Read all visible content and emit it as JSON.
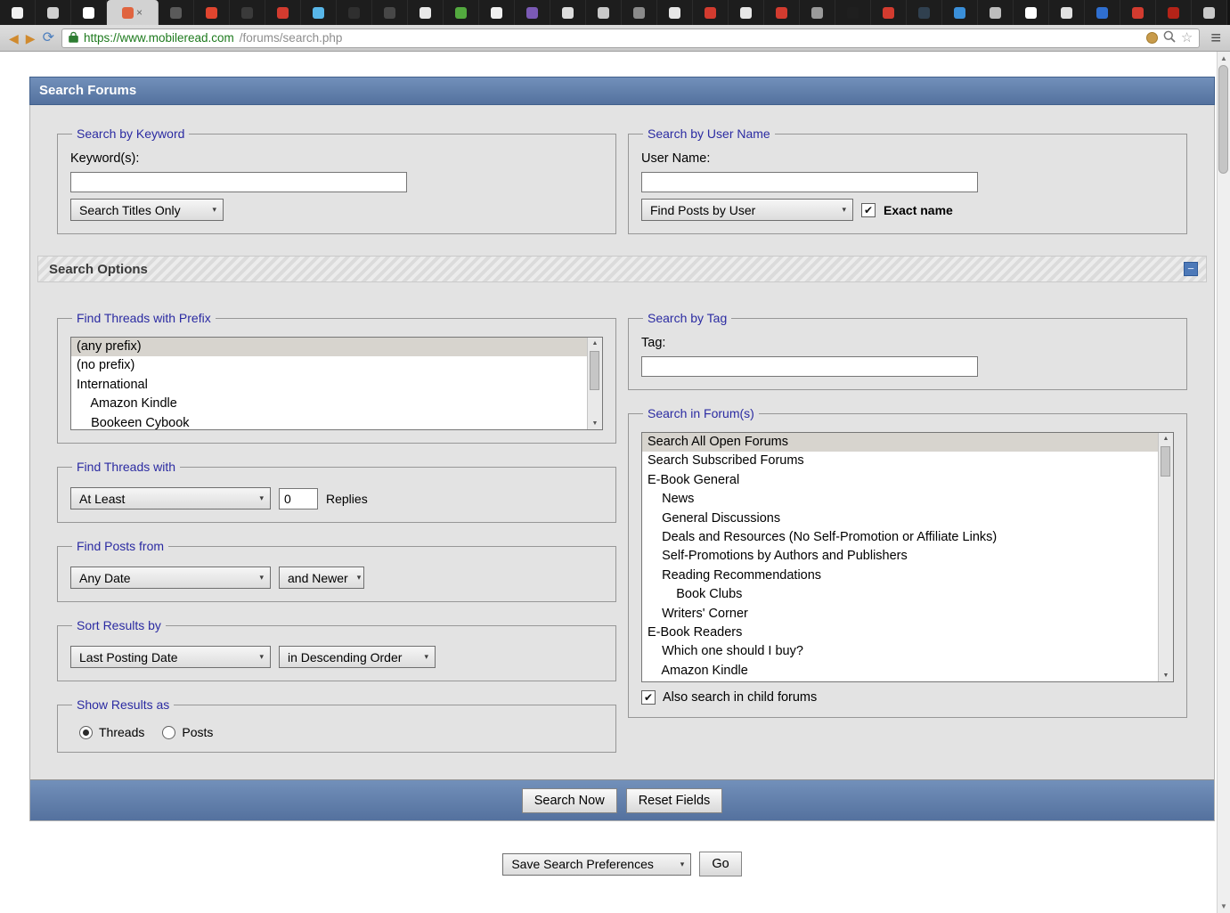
{
  "browser": {
    "tab_colors": [
      "#f0f0f0",
      "#cfcfcf",
      "#ffffff",
      "#e0643f",
      "#5a5a5a",
      "#e0452f",
      "#3a3a3a",
      "#d23b2f",
      "#58b6e8",
      "#2f2f2f",
      "#474747",
      "#e8e8e8",
      "#53a93f",
      "#f0f0f0",
      "#7b5ab5",
      "#dcdcdc",
      "#c9c9c9",
      "#8a8a8a",
      "#e6e6e6",
      "#d23b2f",
      "#e6e6e6",
      "#d23b2f",
      "#9a9a9a",
      "#1f1f1f",
      "#d23b2f",
      "#30404f",
      "#3a8fd9",
      "#bdbdbd",
      "#ffffff",
      "#e0e0e0",
      "#2f6fd0",
      "#d23b2f",
      "#b42318",
      "#c9c9c9"
    ],
    "active_tab_index": 3,
    "url": {
      "scheme_host": "https://www.mobileread.com",
      "path": "/forums/search.php"
    }
  },
  "icons": {
    "back": "◀",
    "forward": "▶",
    "reload": "⟳",
    "star": "☆",
    "menu": "≡",
    "caret": "▾",
    "arrow_up": "▲",
    "arrow_down": "▼",
    "check": "✔",
    "close": "×",
    "collapse": "−"
  },
  "colors": {
    "header_blue": "#5d7ba8",
    "legend_blue": "#2b2ba2",
    "selected_item_gray": "#d7d4ce"
  },
  "header": {
    "title": "Search Forums"
  },
  "options": {
    "title": "Search Options"
  },
  "keyword": {
    "legend": "Search by Keyword",
    "label": "Keyword(s):",
    "input_value": "",
    "select_value": "Search Titles Only"
  },
  "username": {
    "legend": "Search by User Name",
    "label": "User Name:",
    "input_value": "",
    "select_value": "Find Posts by User",
    "exact_label": "Exact name"
  },
  "prefix": {
    "legend": "Find Threads with Prefix",
    "items": [
      "(any prefix)",
      "(no prefix)",
      "International",
      "    Amazon Kindle",
      "    Bookeen Cybook"
    ]
  },
  "threads_with": {
    "legend": "Find Threads with",
    "select_value": "At Least",
    "replies_value": "0",
    "replies_label": "Replies"
  },
  "posts_from": {
    "legend": "Find Posts from",
    "date_value": "Any Date",
    "direction_value": "and Newer"
  },
  "sort": {
    "legend": "Sort Results by",
    "field_value": "Last Posting Date",
    "order_value": "in Descending Order"
  },
  "show_as": {
    "legend": "Show Results as",
    "threads_label": "Threads",
    "posts_label": "Posts"
  },
  "tag": {
    "legend": "Search by Tag",
    "label": "Tag:",
    "input_value": ""
  },
  "forums": {
    "legend": "Search in Forum(s)",
    "items": [
      "Search All Open Forums",
      "Search Subscribed Forums",
      "E-Book General",
      "    News",
      "    General Discussions",
      "    Deals and Resources (No Self-Promotion or Affiliate Links)",
      "    Self-Promotions by Authors and Publishers",
      "    Reading Recommendations",
      "        Book Clubs",
      "    Writers' Corner",
      "E-Book Readers",
      "    Which one should I buy?",
      "    Amazon Kindle"
    ],
    "child_label": "Also search in child forums"
  },
  "footer": {
    "search": "Search Now",
    "reset": "Reset Fields"
  },
  "savebar": {
    "select_value": "Save Search Preferences",
    "go": "Go"
  }
}
